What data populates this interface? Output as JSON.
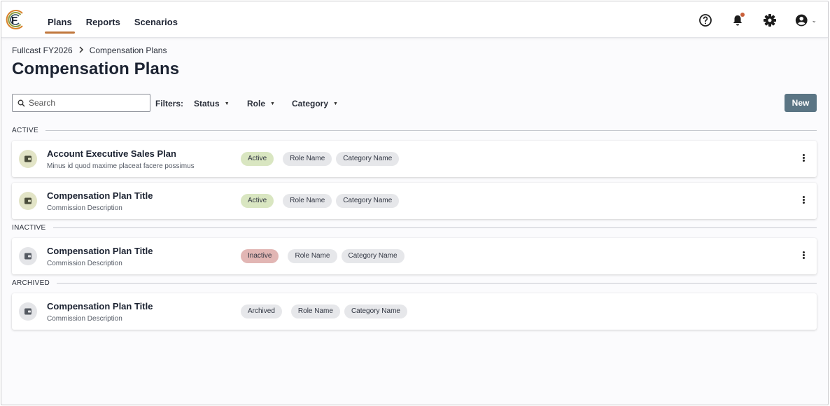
{
  "nav": {
    "items": [
      {
        "label": "Plans",
        "active": true
      },
      {
        "label": "Reports",
        "active": false
      },
      {
        "label": "Scenarios",
        "active": false
      }
    ],
    "icons": [
      "help-icon",
      "bell-icon",
      "gear-icon",
      "account-icon"
    ]
  },
  "breadcrumb": {
    "root": "Fullcast FY2026",
    "current": "Compensation Plans"
  },
  "page": {
    "title": "Compensation Plans"
  },
  "toolbar": {
    "search_placeholder": "Search",
    "filters_label": "Filters:",
    "filters": [
      "Status",
      "Role",
      "Category"
    ],
    "new_label": "New"
  },
  "colors": {
    "accent": "#c0773c",
    "new_button": "#5b7584",
    "active_chip": "#d9e6c1",
    "inactive_chip": "#e2b6b4",
    "neutral_chip": "#e6e7ea",
    "active_icon_bg": "#e2e4c6",
    "muted_icon_bg": "#e4e5e8"
  },
  "sections": [
    {
      "label": "ACTIVE",
      "plans": [
        {
          "title": "Account Executive Sales Plan",
          "description": "Minus id quod maxime placeat facere possimus",
          "status": "Active",
          "role": "Role Name",
          "category": "Category Name",
          "menu": true
        },
        {
          "title": "Compensation Plan Title",
          "description": "Commission Description",
          "status": "Active",
          "role": "Role Name",
          "category": "Category Name",
          "menu": true
        }
      ]
    },
    {
      "label": "INACTIVE",
      "plans": [
        {
          "title": "Compensation Plan Title",
          "description": "Commission Description",
          "status": "Inactive",
          "role": "Role Name",
          "category": "Category Name",
          "menu": true
        }
      ]
    },
    {
      "label": "ARCHIVED",
      "plans": [
        {
          "title": "Compensation Plan Title",
          "description": "Commission Description",
          "status": "Archived",
          "role": "Role Name",
          "category": "Category Name",
          "menu": false
        }
      ]
    }
  ]
}
